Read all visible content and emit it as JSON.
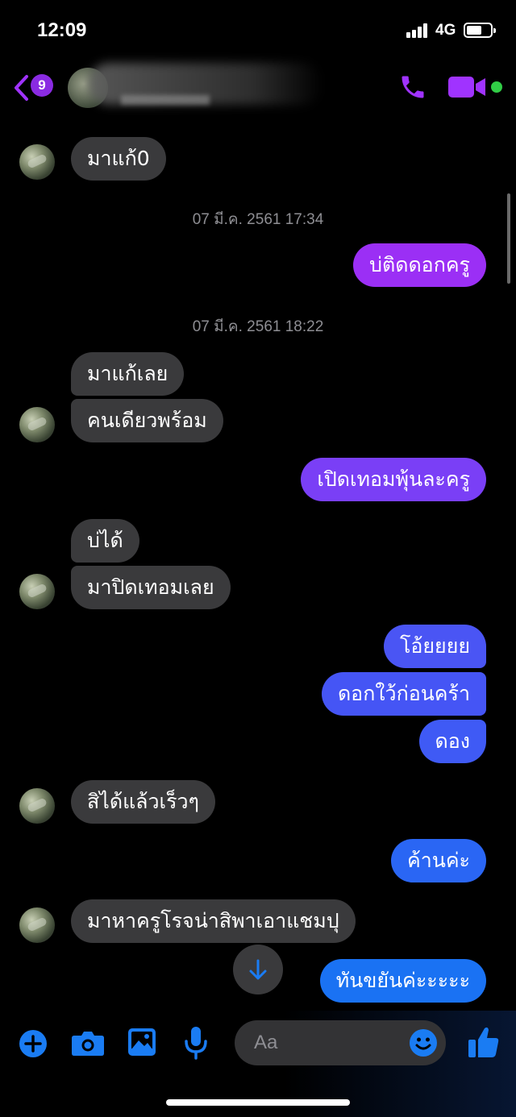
{
  "status_bar": {
    "time": "12:09",
    "network": "4G"
  },
  "header": {
    "unread_count": "9"
  },
  "messages": [
    {
      "text": "มาแก้0"
    },
    {
      "text": "07 มี.ค. 2561 17:34"
    },
    {
      "text": "บ่ติดดอกครู"
    },
    {
      "text": "07 มี.ค. 2561 18:22"
    },
    {
      "text": "มาแก้เลย"
    },
    {
      "text": "คนเดียวพร้อม"
    },
    {
      "text": "เปิดเทอมพุ้นละครู"
    },
    {
      "text": "บ่ได้"
    },
    {
      "text": "มาปิดเทอมเลย"
    },
    {
      "text": "โอ้ยยยย"
    },
    {
      "text": "ดอกใว้ก่อนคร้า"
    },
    {
      "text": "ดอง"
    },
    {
      "text": "สิได้แล้วเร็วๆ"
    },
    {
      "text": "ค้านค่ะ"
    },
    {
      "text": "มาหาครูโรจน่าสิพาเอาแชมปุ"
    },
    {
      "text": "ทันขยันค่ะะะะะ"
    }
  ],
  "composer": {
    "placeholder": "Aa"
  },
  "colors": {
    "accent": "#a033ff",
    "incoming_bubble": "#3a3a3c",
    "outgoing_gradient": [
      "#9b2ff5",
      "#7b3ff6",
      "#4a55f4",
      "#1a72f3"
    ],
    "online": "#31cc46",
    "composer_icons": "#1a7cf3"
  },
  "icons": [
    "back-chevron-icon",
    "phone-icon",
    "video-camera-icon",
    "arrow-down-icon",
    "plus-icon",
    "camera-icon",
    "image-icon",
    "microphone-icon",
    "emoji-icon",
    "thumbs-up-icon"
  ]
}
